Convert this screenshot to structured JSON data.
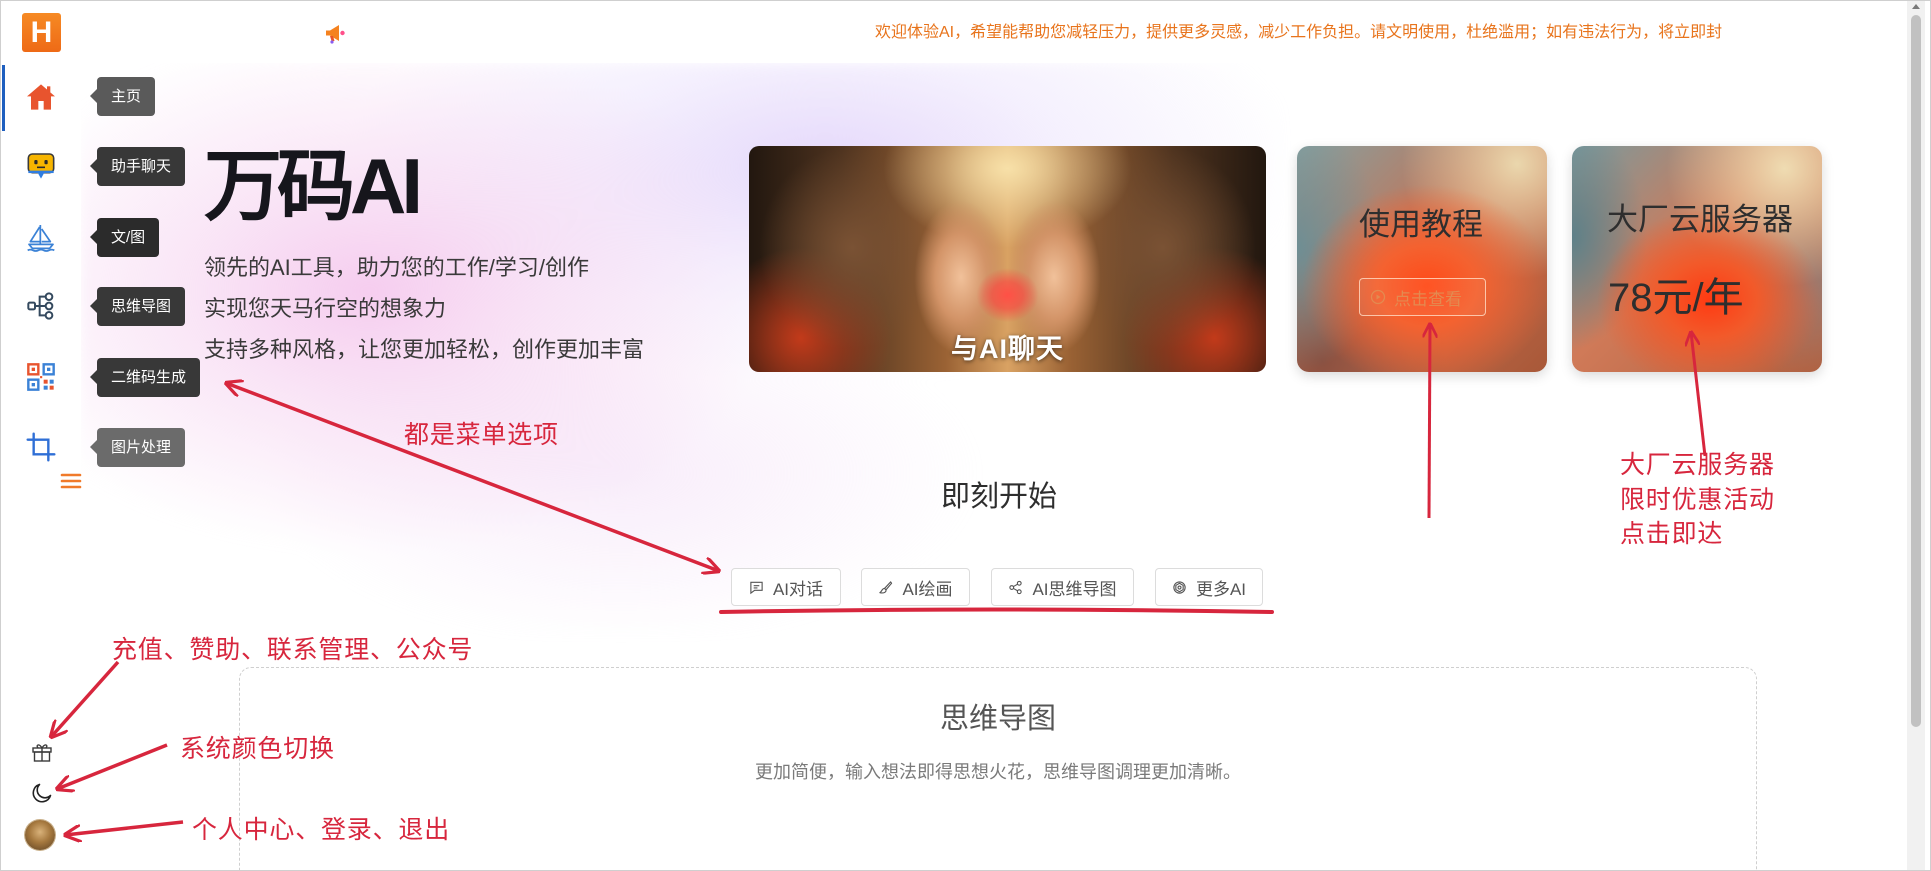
{
  "topbar": {
    "logo_letter": "H",
    "megaphone_icon": "megaphone-icon",
    "notice": "欢迎体验AI，希望能帮助您减轻压力，提供更多灵感，减少工作负担。请文明使用，杜绝滥用；如有违法行为，将立即封"
  },
  "sidebar": {
    "items": [
      {
        "label": "主页",
        "icon": "home-icon"
      },
      {
        "label": "助手聊天",
        "icon": "chat-robot-icon"
      },
      {
        "label": "文/图",
        "icon": "sailboat-icon"
      },
      {
        "label": "思维导图",
        "icon": "mindmap-icon"
      },
      {
        "label": "二维码生成",
        "icon": "qrcode-icon"
      },
      {
        "label": "图片处理",
        "icon": "crop-icon"
      }
    ],
    "menu_toggle_icon": "hamburger-icon",
    "bottom_tools": [
      {
        "icon": "gift-icon"
      },
      {
        "icon": "moon-icon"
      },
      {
        "icon": "avatar"
      }
    ]
  },
  "hero": {
    "title": "万码AI",
    "lines": [
      "领先的AI工具，助力您的工作/学习/创作",
      "实现您天马行空的想象力",
      "支持多种风格，让您更加轻松，创作更加丰富"
    ]
  },
  "banner": {
    "caption": "与AI聊天"
  },
  "cards": [
    {
      "title": "使用教程",
      "button": "点击查看",
      "button_icon": "play-circle-icon"
    },
    {
      "title": "大厂云服务器",
      "price": "78元/年"
    }
  ],
  "start": {
    "title": "即刻开始",
    "buttons": [
      {
        "label": "AI对话",
        "icon": "chat-bubble-icon"
      },
      {
        "label": "AI绘画",
        "icon": "brush-icon"
      },
      {
        "label": "AI思维导图",
        "icon": "share-nodes-icon"
      },
      {
        "label": "更多AI",
        "icon": "openai-icon"
      }
    ]
  },
  "feature": {
    "title": "思维导图",
    "desc": "更加简便，输入想法即得思想火花，思维导图调理更加清晰。"
  },
  "annotations": {
    "menu": "都是菜单选项",
    "bottom_tools": "充值、赞助、联系管理、公众号",
    "theme": "系统颜色切换",
    "user": "个人中心、登录、退出",
    "promo": [
      "大厂云服务器",
      "限时优惠活动",
      "点击即达"
    ]
  },
  "colors": {
    "notice_orange": "#e8741c",
    "annotation_red": "#d7263d",
    "active_blue": "#1f5fbf",
    "logo_orange": "#f47c20"
  }
}
